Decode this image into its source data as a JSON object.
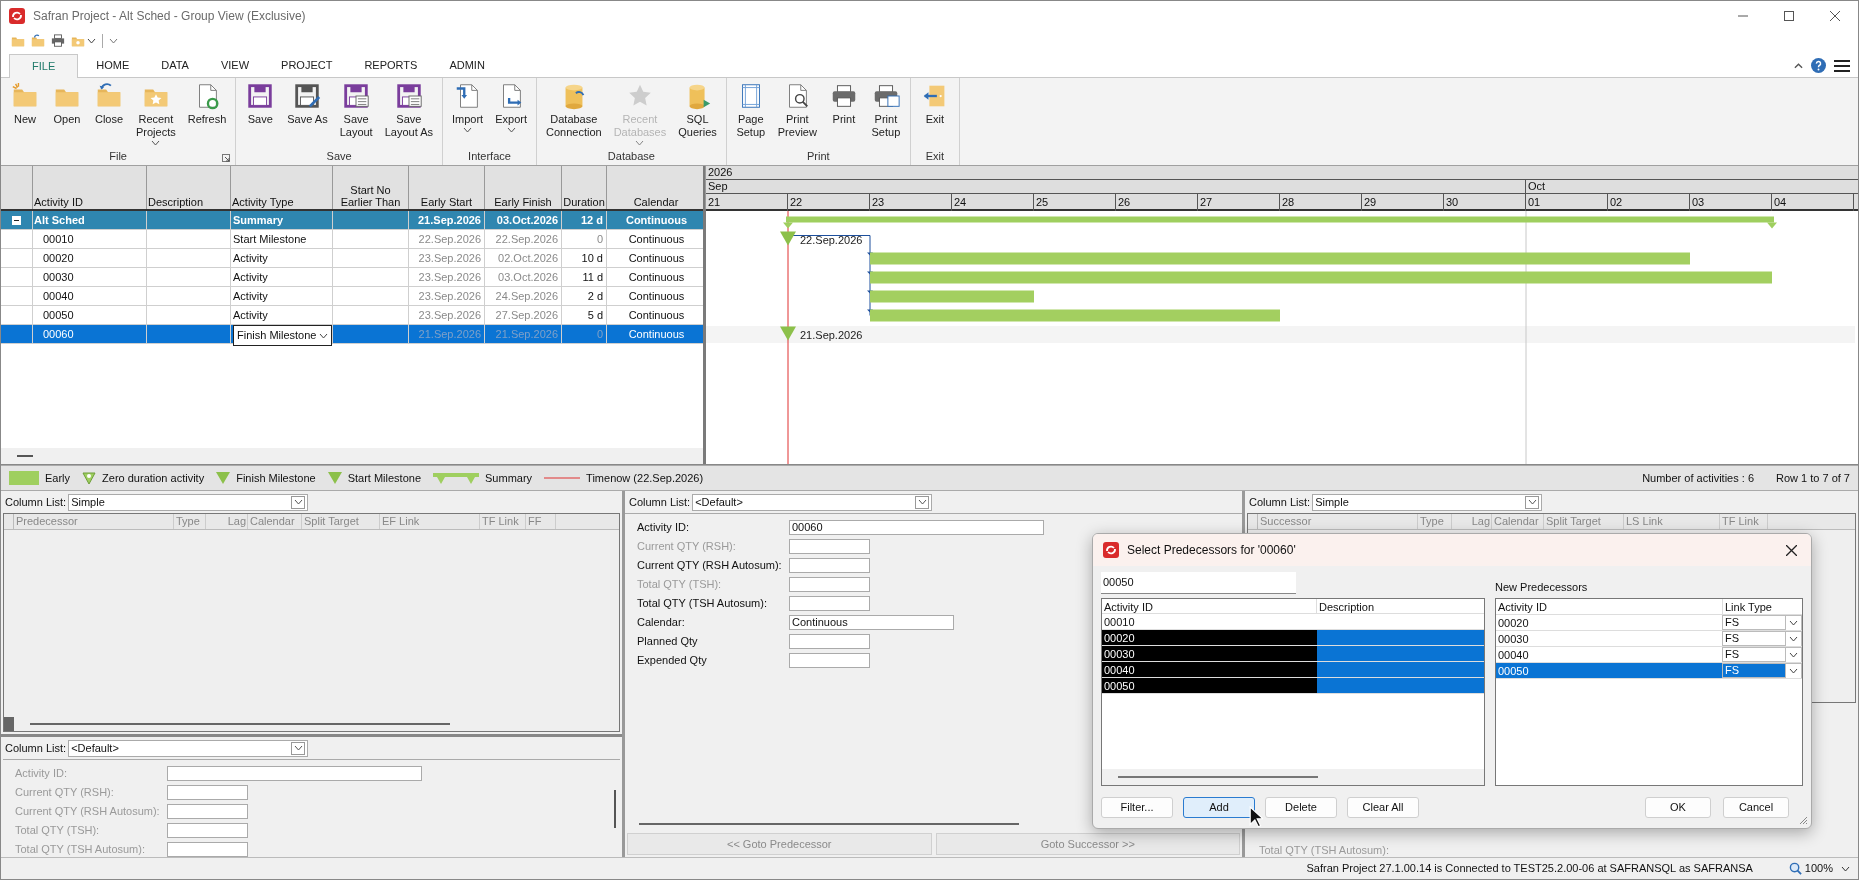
{
  "window": {
    "title": "Safran Project - Alt Sched - Group View (Exclusive)"
  },
  "ribbon_tabs": [
    {
      "label": "FILE",
      "selected": true
    },
    {
      "label": "HOME",
      "selected": false
    },
    {
      "label": "DATA",
      "selected": false
    },
    {
      "label": "VIEW",
      "selected": false
    },
    {
      "label": "PROJECT",
      "selected": false
    },
    {
      "label": "REPORTS",
      "selected": false
    },
    {
      "label": "ADMIN",
      "selected": false
    }
  ],
  "ribbon_groups": [
    {
      "title": "File",
      "launcher": true,
      "buttons": [
        {
          "label": "New",
          "dropdown": false,
          "disabled": false
        },
        {
          "label": "Open",
          "dropdown": false,
          "disabled": false
        },
        {
          "label": "Close",
          "dropdown": false,
          "disabled": false
        },
        {
          "label": "Recent\nProjects",
          "dropdown": true,
          "disabled": false
        },
        {
          "label": "Refresh",
          "dropdown": false,
          "disabled": false
        }
      ]
    },
    {
      "title": "Save",
      "launcher": false,
      "buttons": [
        {
          "label": "Save",
          "dropdown": false,
          "disabled": false
        },
        {
          "label": "Save As",
          "dropdown": false,
          "disabled": false
        },
        {
          "label": "Save\nLayout",
          "dropdown": false,
          "disabled": false
        },
        {
          "label": "Save\nLayout As",
          "dropdown": false,
          "disabled": false
        }
      ]
    },
    {
      "title": "Interface",
      "launcher": false,
      "buttons": [
        {
          "label": "Import",
          "dropdown": true,
          "disabled": false
        },
        {
          "label": "Export",
          "dropdown": true,
          "disabled": false
        }
      ]
    },
    {
      "title": "Database",
      "launcher": false,
      "buttons": [
        {
          "label": "Database\nConnection",
          "dropdown": false,
          "disabled": false
        },
        {
          "label": "Recent\nDatabases",
          "dropdown": true,
          "disabled": true
        },
        {
          "label": "SQL\nQueries",
          "dropdown": false,
          "disabled": false
        }
      ]
    },
    {
      "title": "Print",
      "launcher": false,
      "buttons": [
        {
          "label": "Page\nSetup",
          "dropdown": false,
          "disabled": false
        },
        {
          "label": "Print\nPreview",
          "dropdown": false,
          "disabled": false
        },
        {
          "label": "Print",
          "dropdown": false,
          "disabled": false
        },
        {
          "label": "Print\nSetup",
          "dropdown": false,
          "disabled": false
        }
      ]
    },
    {
      "title": "Exit",
      "launcher": false,
      "buttons": [
        {
          "label": "Exit",
          "dropdown": false,
          "disabled": false
        }
      ]
    }
  ],
  "grid": {
    "columns": [
      "Activity ID",
      "Description",
      "Activity Type",
      "Start No Earlier Than",
      "Early Start",
      "Early Finish",
      "Duration",
      "Calendar"
    ],
    "rows": [
      {
        "kind": "summary",
        "expanded": true,
        "selected": false,
        "activity_id": "Alt Sched",
        "activity_type": "Summary",
        "early_start": "21.Sep.2026",
        "early_finish": "03.Oct.2026",
        "duration": "12 d",
        "calendar": "Continuous"
      },
      {
        "kind": "activity",
        "selected": false,
        "activity_id": "00010",
        "activity_type": "Start Milestone",
        "early_start": "22.Sep.2026",
        "early_finish": "22.Sep.2026",
        "duration": "0",
        "calendar": "Continuous"
      },
      {
        "kind": "activity",
        "selected": false,
        "activity_id": "00020",
        "activity_type": "Activity",
        "early_start": "23.Sep.2026",
        "early_finish": "02.Oct.2026",
        "duration": "10 d",
        "calendar": "Continuous"
      },
      {
        "kind": "activity",
        "selected": false,
        "activity_id": "00030",
        "activity_type": "Activity",
        "early_start": "23.Sep.2026",
        "early_finish": "03.Oct.2026",
        "duration": "11 d",
        "calendar": "Continuous"
      },
      {
        "kind": "activity",
        "selected": false,
        "activity_id": "00040",
        "activity_type": "Activity",
        "early_start": "23.Sep.2026",
        "early_finish": "24.Sep.2026",
        "duration": "2 d",
        "calendar": "Continuous"
      },
      {
        "kind": "activity",
        "selected": false,
        "activity_id": "00050",
        "activity_type": "Activity",
        "early_start": "23.Sep.2026",
        "early_finish": "27.Sep.2026",
        "duration": "5 d",
        "calendar": "Continuous"
      },
      {
        "kind": "activity",
        "selected": true,
        "activity_id": "00060",
        "activity_type": "Finish Milestone",
        "early_start": "21.Sep.2026",
        "early_finish": "21.Sep.2026",
        "duration": "0",
        "calendar": "Continuous"
      }
    ]
  },
  "gantt": {
    "year": "2026",
    "months": [
      "Sep",
      "Oct"
    ],
    "days": [
      "21",
      "22",
      "23",
      "24",
      "25",
      "26",
      "27",
      "28",
      "29",
      "30",
      "01",
      "02",
      "03",
      "04"
    ],
    "milestone_labels": [
      "22.Sep.2026",
      "21.Sep.2026"
    ]
  },
  "legend": [
    {
      "kind": "bar",
      "label": "Early"
    },
    {
      "kind": "zero",
      "label": "Zero duration activity"
    },
    {
      "kind": "finish",
      "label": "Finish Milestone"
    },
    {
      "kind": "start",
      "label": "Start Milestone"
    },
    {
      "kind": "summary",
      "label": "Summary"
    },
    {
      "kind": "line",
      "label": "Timenow (22.Sep.2026)"
    }
  ],
  "grid_status": {
    "count": "Number of activities : 6",
    "rows": "Row 1 to 7 of 7"
  },
  "predecessor_panel": {
    "column_list_label": "Column List:",
    "column_list": "Simple",
    "columns": [
      "Predecessor",
      "Type",
      "Lag",
      "Calendar",
      "Split Target",
      "EF Link",
      "TF Link",
      "FF"
    ]
  },
  "left_detail_panel": {
    "column_list_label": "Column List:",
    "column_list": "<Default>",
    "fields": [
      {
        "label": "Activity ID:",
        "disabled": true,
        "kind": "long"
      },
      {
        "label": "Current QTY (RSH):",
        "disabled": true,
        "kind": "short"
      },
      {
        "label": "Current QTY (RSH Autosum):",
        "disabled": true,
        "kind": "short"
      },
      {
        "label": "Total QTY (TSH):",
        "disabled": true,
        "kind": "short"
      },
      {
        "label": "Total QTY (TSH Autosum):",
        "disabled": true,
        "kind": "short"
      }
    ]
  },
  "detail_panel": {
    "column_list_label": "Column List:",
    "column_list": "<Default>",
    "fields": [
      {
        "label": "Activity ID:",
        "value": "00060",
        "disabled": false,
        "kind": "long"
      },
      {
        "label": "Current QTY (RSH):",
        "disabled": true,
        "kind": "short"
      },
      {
        "label": "Current QTY (RSH Autosum):",
        "disabled": false,
        "kind": "short"
      },
      {
        "label": "Total QTY (TSH):",
        "disabled": true,
        "kind": "short"
      },
      {
        "label": "Total QTY (TSH Autosum):",
        "disabled": false,
        "kind": "short"
      },
      {
        "label": "Calendar:",
        "value": "Continuous",
        "disabled": false,
        "kind": "medium"
      },
      {
        "label": "Planned Qty",
        "disabled": false,
        "kind": "short"
      },
      {
        "label": "Expended Qty",
        "disabled": false,
        "kind": "short"
      }
    ],
    "buttons": [
      "<< Goto Predecessor",
      "Goto Successor >>"
    ]
  },
  "successor_panel": {
    "column_list_label": "Column List:",
    "column_list": "Simple",
    "columns": [
      "Successor",
      "Type",
      "Lag",
      "Calendar",
      "Split Target",
      "LS Link",
      "TF Link"
    ],
    "field_label": "Total QTY (TSH Autosum):"
  },
  "dialog": {
    "title": "Select Predecessors for '00060'",
    "search_value": "00050",
    "list_columns": [
      "Activity ID",
      "Description"
    ],
    "list_rows": [
      {
        "activity_id": "00010",
        "selected": false
      },
      {
        "activity_id": "00020",
        "selected": true
      },
      {
        "activity_id": "00030",
        "selected": true
      },
      {
        "activity_id": "00040",
        "selected": true
      },
      {
        "activity_id": "00050",
        "selected": true
      }
    ],
    "new_label": "New Predecessors",
    "new_columns": [
      "Activity ID",
      "Link Type"
    ],
    "new_rows": [
      {
        "activity_id": "00020",
        "link_type": "FS",
        "selected": false
      },
      {
        "activity_id": "00030",
        "link_type": "FS",
        "selected": false
      },
      {
        "activity_id": "00040",
        "link_type": "FS",
        "selected": false
      },
      {
        "activity_id": "00050",
        "link_type": "FS",
        "selected": true
      }
    ],
    "left_buttons": [
      {
        "label": "Filter...",
        "focused": false
      },
      {
        "label": "Add",
        "focused": true
      },
      {
        "label": "Delete",
        "focused": false
      },
      {
        "label": "Clear All",
        "focused": false
      }
    ],
    "right_buttons": [
      {
        "label": "OK",
        "focused": false
      },
      {
        "label": "Cancel",
        "focused": false
      }
    ]
  },
  "status_bar": {
    "text": "Safran Project 27.1.00.14 is Connected to TEST25.2.00-06 at SAFRANSQL as SAFRANSA",
    "zoom": "100%"
  }
}
